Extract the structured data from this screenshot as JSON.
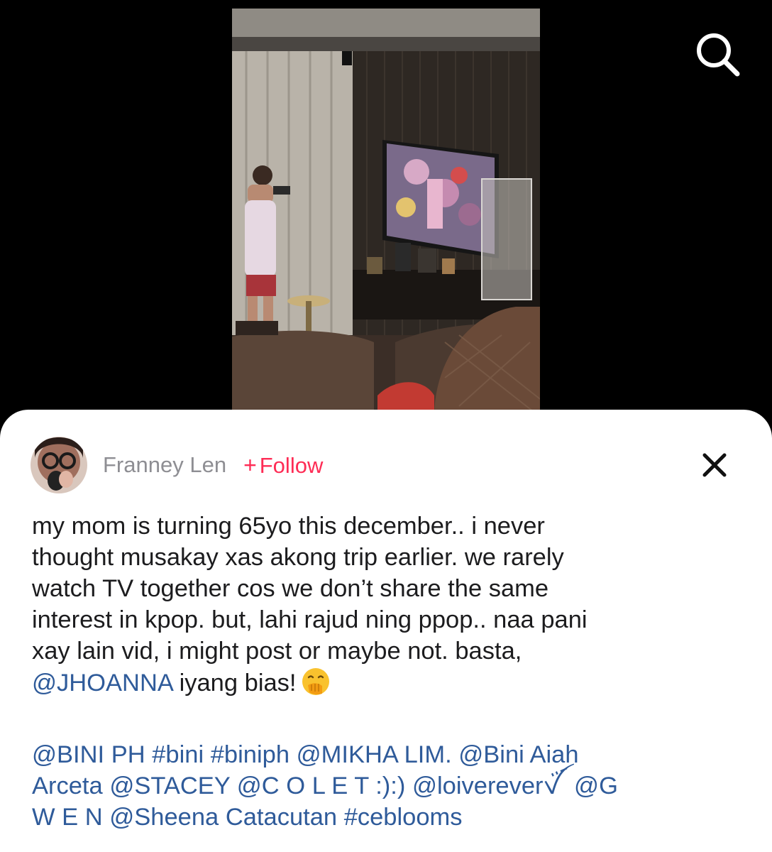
{
  "video": {
    "icon": "video-thumbnail"
  },
  "top_bar": {
    "search_icon": "search-icon"
  },
  "post": {
    "author": {
      "name": "Franney Len",
      "avatar_icon": "avatar"
    },
    "follow_label": "Follow",
    "follow_plus": "+",
    "close_icon": "close-icon",
    "caption_lines": [
      "my mom is turning 65yo this december.. i never",
      "thought musakay xas akong trip earlier. we rarely",
      "watch TV together cos we don’t share the same",
      "interest in kpop. but, lahi rajud ning ppop.. naa pani",
      "xay lain vid, i might post or maybe not. basta,"
    ],
    "caption_mention": "@JHOANNA",
    "caption_tail": " iyang bias!",
    "emoji_icon": "hand-over-mouth-emoji",
    "tags": [
      "@BINI PH",
      "#bini",
      "#biniph",
      "@MIKHA LIM.",
      "@Bini Aiah",
      "Arceta",
      "@STACEY",
      "@C O L E T :):)",
      "@loivereverꪜ ꪾ",
      "@G",
      "W E N",
      "@Sheena Catacutan",
      "#ceblooms"
    ]
  },
  "colors": {
    "accent": "#fe2c55",
    "mention": "#2f5b9a",
    "author": "#8e8e93",
    "text": "#1c1c1e"
  }
}
